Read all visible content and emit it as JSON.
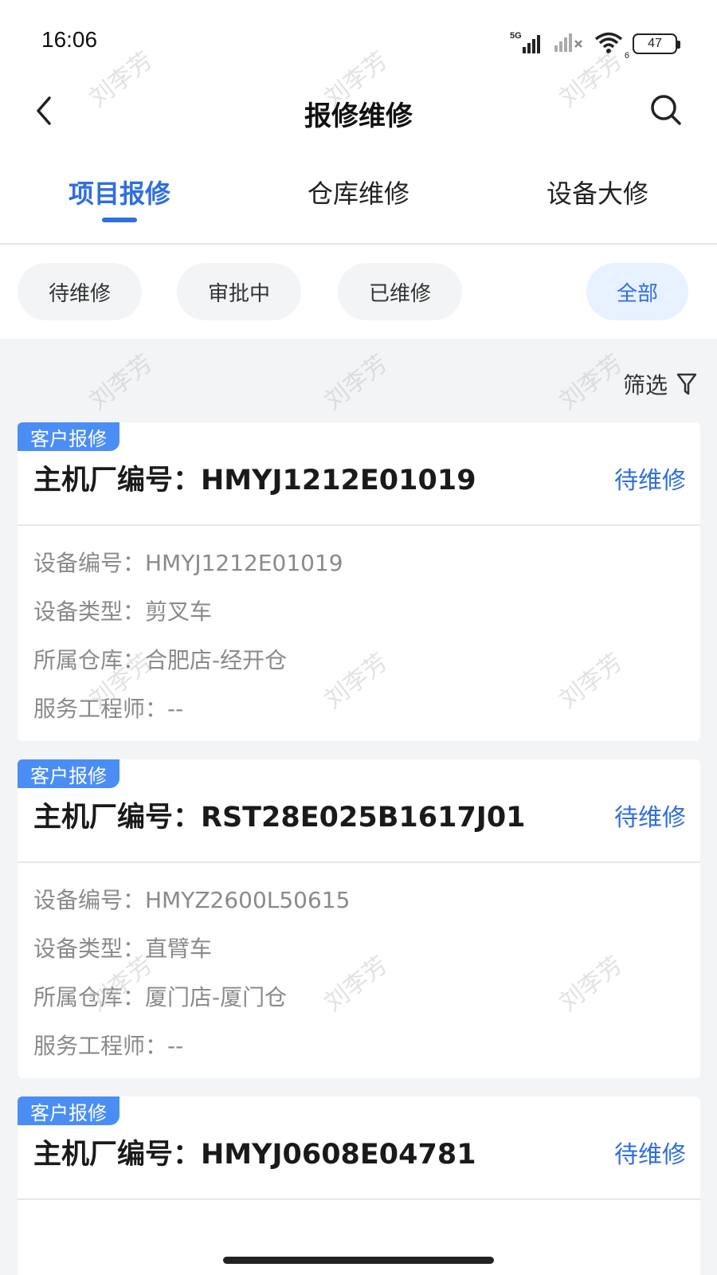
{
  "status_bar": {
    "time": "16:06",
    "network": "5G",
    "wifi_badge": "6",
    "battery": "47"
  },
  "nav": {
    "title": "报修维修",
    "back_icon": "chevron-left-icon",
    "search_icon": "search-icon"
  },
  "tabs": [
    {
      "label": "项目报修",
      "active": true
    },
    {
      "label": "仓库维修",
      "active": false
    },
    {
      "label": "设备大修",
      "active": false
    }
  ],
  "chips": [
    {
      "label": "待维修",
      "active": false
    },
    {
      "label": "审批中",
      "active": false
    },
    {
      "label": "已维修",
      "active": false
    },
    {
      "label": "全部",
      "active": true
    }
  ],
  "filter": {
    "label": "筛选",
    "icon": "filter-icon"
  },
  "cards": [
    {
      "tag": "客户报修",
      "title": "主机厂编号：HMYJ1212E01019",
      "status": "待维修",
      "details": [
        "设备编号：HMYJ1212E01019",
        "设备类型：剪叉车",
        "所属仓库：合肥店-经开仓",
        "服务工程师：--"
      ]
    },
    {
      "tag": "客户报修",
      "title": "主机厂编号：RST28E025B1617J01",
      "status": "待维修",
      "details": [
        "设备编号：HMYZ2600L50615",
        "设备类型：直臂车",
        "所属仓库：厦门店-厦门仓",
        "服务工程师：--"
      ]
    },
    {
      "tag": "客户报修",
      "title": "主机厂编号：HMYJ0608E04781",
      "status": "待维修",
      "details": []
    }
  ],
  "watermark": "刘李芳",
  "colors": {
    "accent": "#2f6fde",
    "tag": "#4a8ef5",
    "page_bg": "#f3f4f6"
  }
}
